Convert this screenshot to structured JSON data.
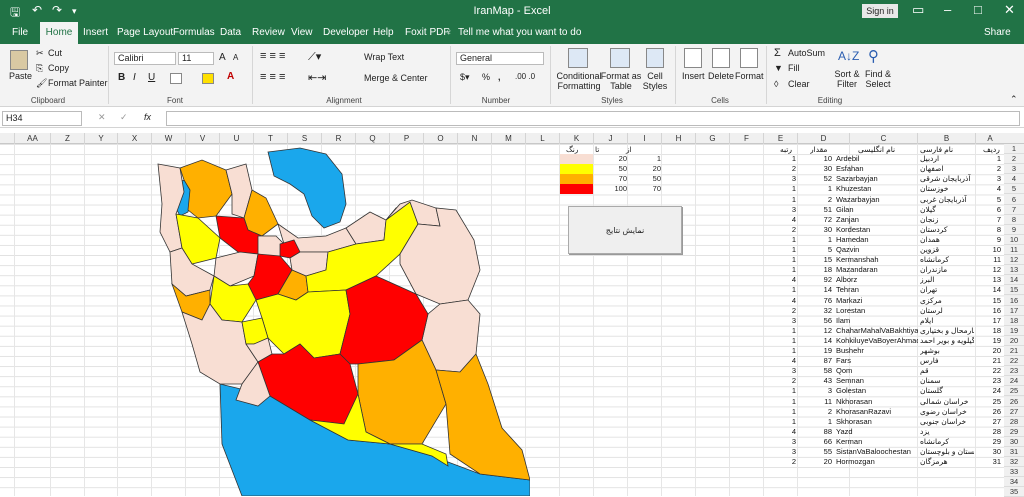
{
  "title_bar": {
    "doc_title": "IranMap  -  Excel",
    "signin": "Sign in",
    "share": "Share"
  },
  "tabs": [
    "File",
    "Home",
    "Insert",
    "Page Layout",
    "Formulas",
    "Data",
    "Review",
    "View",
    "Developer",
    "Help",
    "Foxit PDF"
  ],
  "tell_me": "Tell me what you want to do",
  "ribbon": {
    "clipboard": {
      "paste": "Paste",
      "cut": "Cut",
      "copy": "Copy",
      "format_painter": "Format Painter",
      "label": "Clipboard"
    },
    "font": {
      "name": "Calibri",
      "size": "11",
      "bold": "B",
      "italic": "I",
      "underline": "U",
      "grow": "A",
      "shrink": "A",
      "label": "Font"
    },
    "alignment": {
      "wrap": "Wrap Text",
      "merge": "Merge & Center",
      "label": "Alignment"
    },
    "number": {
      "format": "General",
      "percent": "%",
      "comma": ",",
      "label": "Number"
    },
    "styles": {
      "cond": "Conditional Formatting",
      "table": "Format as Table",
      "cell": "Cell Styles",
      "label": "Styles"
    },
    "cells": {
      "insert": "Insert",
      "delete": "Delete",
      "format": "Format",
      "label": "Cells"
    },
    "editing": {
      "autosum": "AutoSum",
      "fill": "Fill",
      "clear": "Clear",
      "sort": "Sort & Filter",
      "find": "Find & Select",
      "label": "Editing"
    }
  },
  "name_box": "H34",
  "columns": [
    "AA",
    "Z",
    "Y",
    "X",
    "W",
    "V",
    "U",
    "T",
    "S",
    "R",
    "Q",
    "P",
    "O",
    "N",
    "M",
    "L",
    "K",
    "J",
    "I",
    "H",
    "G",
    "F",
    "E",
    "D",
    "C",
    "B",
    "A"
  ],
  "row_numbers": [
    "1",
    "2",
    "3",
    "4",
    "5",
    "6",
    "7",
    "8",
    "9",
    "10",
    "11",
    "12",
    "13",
    "14",
    "15",
    "16",
    "17",
    "18",
    "19",
    "20",
    "21",
    "22",
    "23",
    "24",
    "25",
    "26",
    "27",
    "28",
    "29",
    "30",
    "31",
    "32",
    "33",
    "34",
    "35"
  ],
  "table_headers": {
    "radif": "ردیف",
    "fa": "نام فارسی",
    "en": "نام انگلیسی",
    "value": "مقدار",
    "rank": "رتبه"
  },
  "provinces": [
    {
      "n": "1",
      "fa": "اردبیل",
      "en": "Ardebil",
      "v": "10",
      "r": "1"
    },
    {
      "n": "2",
      "fa": "اصفهان",
      "en": "Esfahan",
      "v": "30",
      "r": "2"
    },
    {
      "n": "3",
      "fa": "آذربایجان شرقی",
      "en": "Sazarbayjan",
      "v": "52",
      "r": "3"
    },
    {
      "n": "4",
      "fa": "خوزستان",
      "en": "Khuzestan",
      "v": "1",
      "r": "1"
    },
    {
      "n": "5",
      "fa": "آذربایجان غربی",
      "en": "Wazarbayjan",
      "v": "2",
      "r": "1"
    },
    {
      "n": "6",
      "fa": "گیلان",
      "en": "Gilan",
      "v": "51",
      "r": "3"
    },
    {
      "n": "7",
      "fa": "زنجان",
      "en": "Zanjan",
      "v": "72",
      "r": "4"
    },
    {
      "n": "8",
      "fa": "کردستان",
      "en": "Kordestan",
      "v": "30",
      "r": "2"
    },
    {
      "n": "9",
      "fa": "همدان",
      "en": "Hamedan",
      "v": "1",
      "r": "1"
    },
    {
      "n": "10",
      "fa": "قزوین",
      "en": "Qazvin",
      "v": "5",
      "r": "1"
    },
    {
      "n": "11",
      "fa": "کرمانشاه",
      "en": "Kermanshah",
      "v": "15",
      "r": "1"
    },
    {
      "n": "12",
      "fa": "مازندران",
      "en": "Mazandaran",
      "v": "18",
      "r": "1"
    },
    {
      "n": "13",
      "fa": "البرز",
      "en": "Alborz",
      "v": "92",
      "r": "4"
    },
    {
      "n": "14",
      "fa": "تهران",
      "en": "Tehran",
      "v": "14",
      "r": "1"
    },
    {
      "n": "15",
      "fa": "مرکزی",
      "en": "Markazi",
      "v": "76",
      "r": "4"
    },
    {
      "n": "16",
      "fa": "لرستان",
      "en": "Lorestan",
      "v": "32",
      "r": "2"
    },
    {
      "n": "17",
      "fa": "ایلام",
      "en": "Ilam",
      "v": "56",
      "r": "3"
    },
    {
      "n": "18",
      "fa": "چهارمحال و بختیاری",
      "en": "ChaharMahalVaBakhtiyari",
      "v": "12",
      "r": "1"
    },
    {
      "n": "19",
      "fa": "کهگیلویه و بویر احمد",
      "en": "KohkiluyeVaBoyerAhmad",
      "v": "14",
      "r": "1"
    },
    {
      "n": "20",
      "fa": "بوشهر",
      "en": "Bushehr",
      "v": "19",
      "r": "1"
    },
    {
      "n": "21",
      "fa": "فارس",
      "en": "Fars",
      "v": "87",
      "r": "4"
    },
    {
      "n": "22",
      "fa": "قم",
      "en": "Qom",
      "v": "58",
      "r": "3"
    },
    {
      "n": "23",
      "fa": "سمنان",
      "en": "Semnan",
      "v": "43",
      "r": "2"
    },
    {
      "n": "24",
      "fa": "گلستان",
      "en": "Golestan",
      "v": "3",
      "r": "1"
    },
    {
      "n": "25",
      "fa": "خراسان شمالی",
      "en": "Nkhorasan",
      "v": "11",
      "r": "1"
    },
    {
      "n": "26",
      "fa": "خراسان رضوی",
      "en": "KhorasanRazavi",
      "v": "2",
      "r": "1"
    },
    {
      "n": "27",
      "fa": "خراسان جنوبی",
      "en": "Skhorasan",
      "v": "1",
      "r": "1"
    },
    {
      "n": "28",
      "fa": "یزد",
      "en": "Yazd",
      "v": "88",
      "r": "4"
    },
    {
      "n": "29",
      "fa": "کرمانشاه",
      "en": "Kerman",
      "v": "66",
      "r": "3"
    },
    {
      "n": "30",
      "fa": "سیستان و بلوچستان",
      "en": "SistanVaBaloochestan",
      "v": "55",
      "r": "3"
    },
    {
      "n": "31",
      "fa": "هرمزگان",
      "en": "Hormozgan",
      "v": "20",
      "r": "2"
    }
  ],
  "legend": {
    "headers": {
      "from": "از",
      "to": "تا",
      "color": "رنگ"
    },
    "rows": [
      {
        "from": "1",
        "to": "20",
        "color": "#f8ded3"
      },
      {
        "from": "20",
        "to": "50",
        "color": "#ffff00"
      },
      {
        "from": "50",
        "to": "70",
        "color": "#ffb000"
      },
      {
        "from": "70",
        "to": "100",
        "color": "#ff0000"
      }
    ]
  },
  "show_results_button": "نمایش نتایج",
  "colors": {
    "excel_green": "#217346",
    "sea": "#1aa7ec"
  }
}
